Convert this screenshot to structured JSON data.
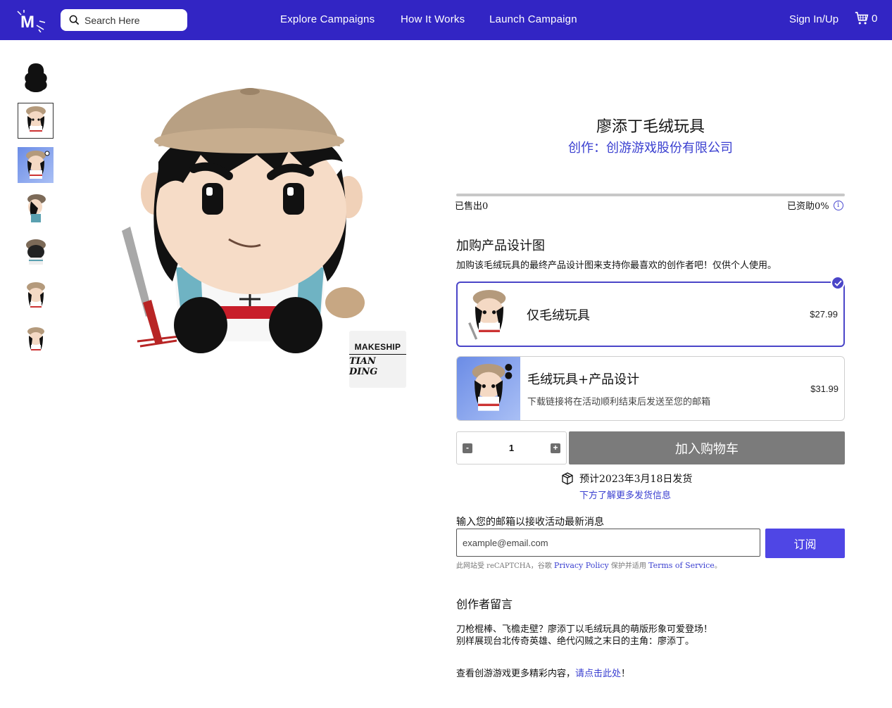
{
  "header": {
    "logo_text": "M",
    "search_placeholder": "Search Here",
    "nav": [
      "Explore Campaigns",
      "How It Works",
      "Launch Campaign"
    ],
    "sign_in": "Sign In/Up",
    "cart_count": "0"
  },
  "badge": {
    "brand": "MAKESHIP",
    "product_logo": "TIAN DING"
  },
  "product": {
    "title": "廖添丁毛绒玩具",
    "creator": "创作：创游游戏股份有限公司",
    "sold": "已售出0",
    "funded": "已资助0%",
    "funded_percent": 0
  },
  "addon": {
    "title": "加购产品设计图",
    "description": "加购该毛绒玩具的最终产品设计图来支持你最喜欢的创作者吧！仅供个人使用。",
    "options": [
      {
        "label": "仅毛绒玩具",
        "price": "$27.99",
        "selected": true
      },
      {
        "label": "毛绒玩具+产品设计",
        "sub": "下载链接将在活动顺利结束后发送至您的邮箱",
        "price": "$31.99",
        "selected": false
      }
    ]
  },
  "purchase": {
    "qty_minus": "-",
    "qty_plus": "+",
    "quantity": "1",
    "add_to_cart": "加入购物车"
  },
  "shipping": {
    "estimate": "预计2023年3月18日发货",
    "link": "下方了解更多发货信息"
  },
  "newsletter": {
    "label": "输入您的邮箱以接收活动最新消息",
    "placeholder": "example@email.com",
    "button": "订阅",
    "recaptcha_prefix": "此网站受 reCAPTCHA，谷歌 ",
    "privacy": "Privacy Policy",
    "recaptcha_mid": " 保护并适用 ",
    "terms": "Terms of Service",
    "recaptcha_suffix": "。"
  },
  "creator_note": {
    "title": "创作者留言",
    "line1": "刀枪棍棒、飞檐走壁？廖添丁以毛绒玩具的萌版形象可爱登场！",
    "line2": "别样展现台北传奇英雄、绝代闪贼之末日的主角：廖添丁。",
    "more_prefix": "查看创游游戏更多精彩内容，",
    "more_link": "请点击此处",
    "more_suffix": "！"
  },
  "colors": {
    "header_bg": "#3225c4",
    "accent": "#4f46e5",
    "link": "#3a3fd0",
    "cart_button": "#7b7b7b"
  }
}
